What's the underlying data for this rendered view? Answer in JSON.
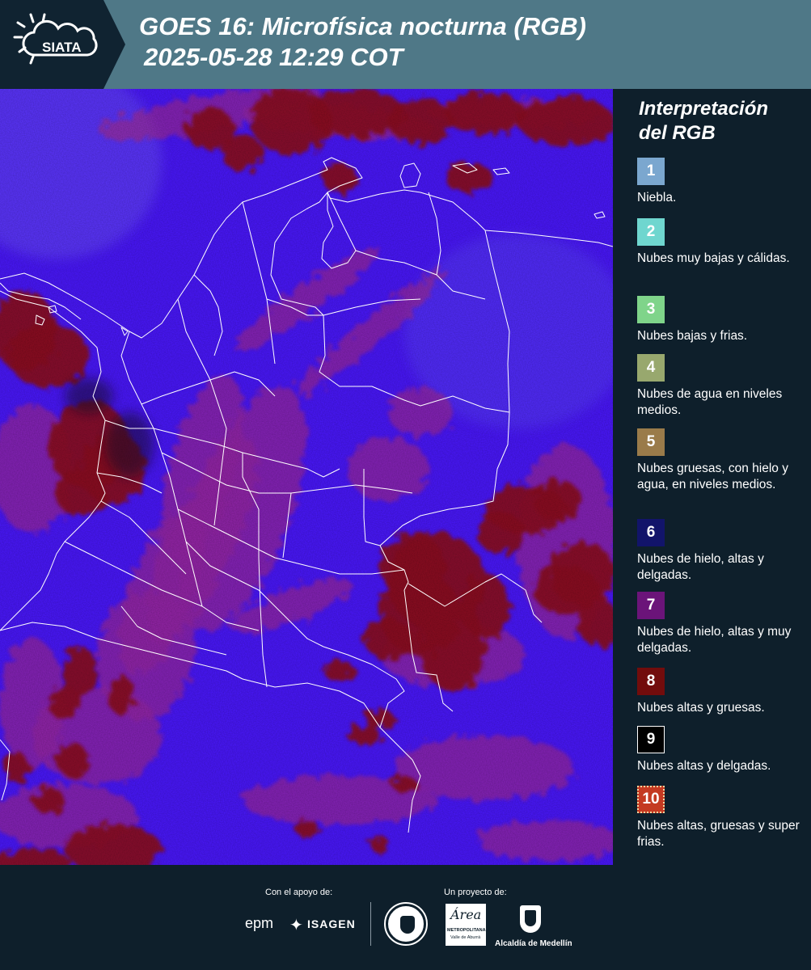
{
  "header": {
    "logo_text": "SIATA",
    "title_line1": "GOES 16: Microfísica nocturna (RGB)",
    "title_line2": "2025-05-28 12:29 COT"
  },
  "legend": {
    "title_line1": "Interpretación",
    "title_line2": "del RGB",
    "items": [
      {
        "num": "1",
        "color": "#7ba7cf",
        "label": "Niebla."
      },
      {
        "num": "2",
        "color": "#6fd6cf",
        "label": "Nubes muy bajas y cálidas."
      },
      {
        "num": "3",
        "color": "#7fd48a",
        "label": "Nubes bajas y frias."
      },
      {
        "num": "4",
        "color": "#98a86e",
        "label": "Nubes de agua en niveles medios."
      },
      {
        "num": "5",
        "color": "#9a7b4a",
        "label": "Nubes gruesas, con hielo y agua, en niveles medios."
      },
      {
        "num": "6",
        "color": "#12146a",
        "label": "Nubes de hielo, altas y delgadas."
      },
      {
        "num": "7",
        "color": "#6b1479",
        "label": "Nubes de hielo, altas y muy delgadas."
      },
      {
        "num": "8",
        "color": "#720c0c",
        "label": "Nubes altas y gruesas."
      },
      {
        "num": "9",
        "color": "#000000",
        "label": "Nubes altas y delgadas."
      },
      {
        "num": "10",
        "color": "#c43a22",
        "label": "Nubes altas, gruesas y super frias."
      }
    ]
  },
  "footer": {
    "support_label": "Con el apoyo de:",
    "project_label": "Un proyecto de:",
    "epm": "epm",
    "isagen": "ISAGEN",
    "area_name": "Área",
    "area_sub": "METROPOLITANA",
    "area_sub2": "Valle de Aburrá",
    "alcaldia": "Alcaldía de Medellín"
  },
  "map": {
    "background_color": "#4b18ff",
    "cloud_thick_color": "#8e0e22",
    "cloud_thin_color": "#b02a8c",
    "border_color": "#ffffff"
  }
}
